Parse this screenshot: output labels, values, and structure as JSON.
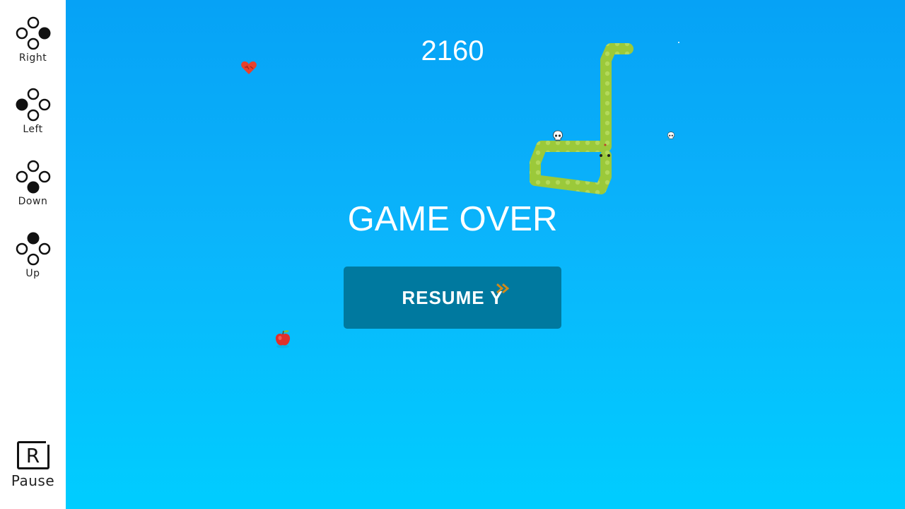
{
  "controls": [
    {
      "label": "Right",
      "direction": "right"
    },
    {
      "label": "Left",
      "direction": "left"
    },
    {
      "label": "Down",
      "direction": "down"
    },
    {
      "label": "Up",
      "direction": "up"
    }
  ],
  "pause": {
    "key": "R",
    "label": "Pause"
  },
  "game": {
    "score": "2160",
    "status": "GAME OVER",
    "resume_label": "RESUME Y"
  },
  "colors": {
    "sky_top": "#06a2f6",
    "sky_bottom": "#00cdff",
    "button": "#00799f",
    "snake": "#9bc93a",
    "text": "#ffffff"
  }
}
